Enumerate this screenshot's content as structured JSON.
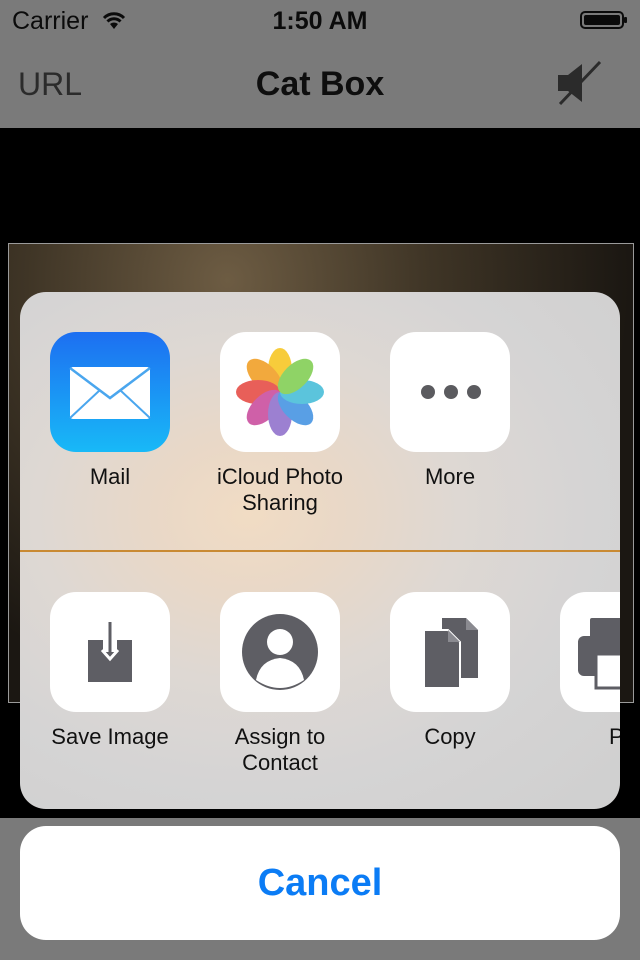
{
  "status": {
    "carrier": "Carrier",
    "time": "1:50 AM"
  },
  "nav": {
    "left_label": "URL",
    "title": "Cat Box",
    "right_icon": "mute-icon"
  },
  "share": {
    "apps": [
      {
        "label": "Mail",
        "icon": "mail-icon"
      },
      {
        "label": "iCloud Photo\nSharing",
        "icon": "photos-icon"
      },
      {
        "label": "More",
        "icon": "more-icon"
      }
    ],
    "actions": [
      {
        "label": "Save Image",
        "icon": "save-image-icon"
      },
      {
        "label": "Assign to\nContact",
        "icon": "contact-icon"
      },
      {
        "label": "Copy",
        "icon": "copy-icon"
      },
      {
        "label": "Pr",
        "icon": "print-icon"
      }
    ]
  },
  "cancel_label": "Cancel",
  "colors": {
    "accent": "#0B7CF5",
    "dim": "#7A7A7A",
    "divider": "#C98A33"
  }
}
